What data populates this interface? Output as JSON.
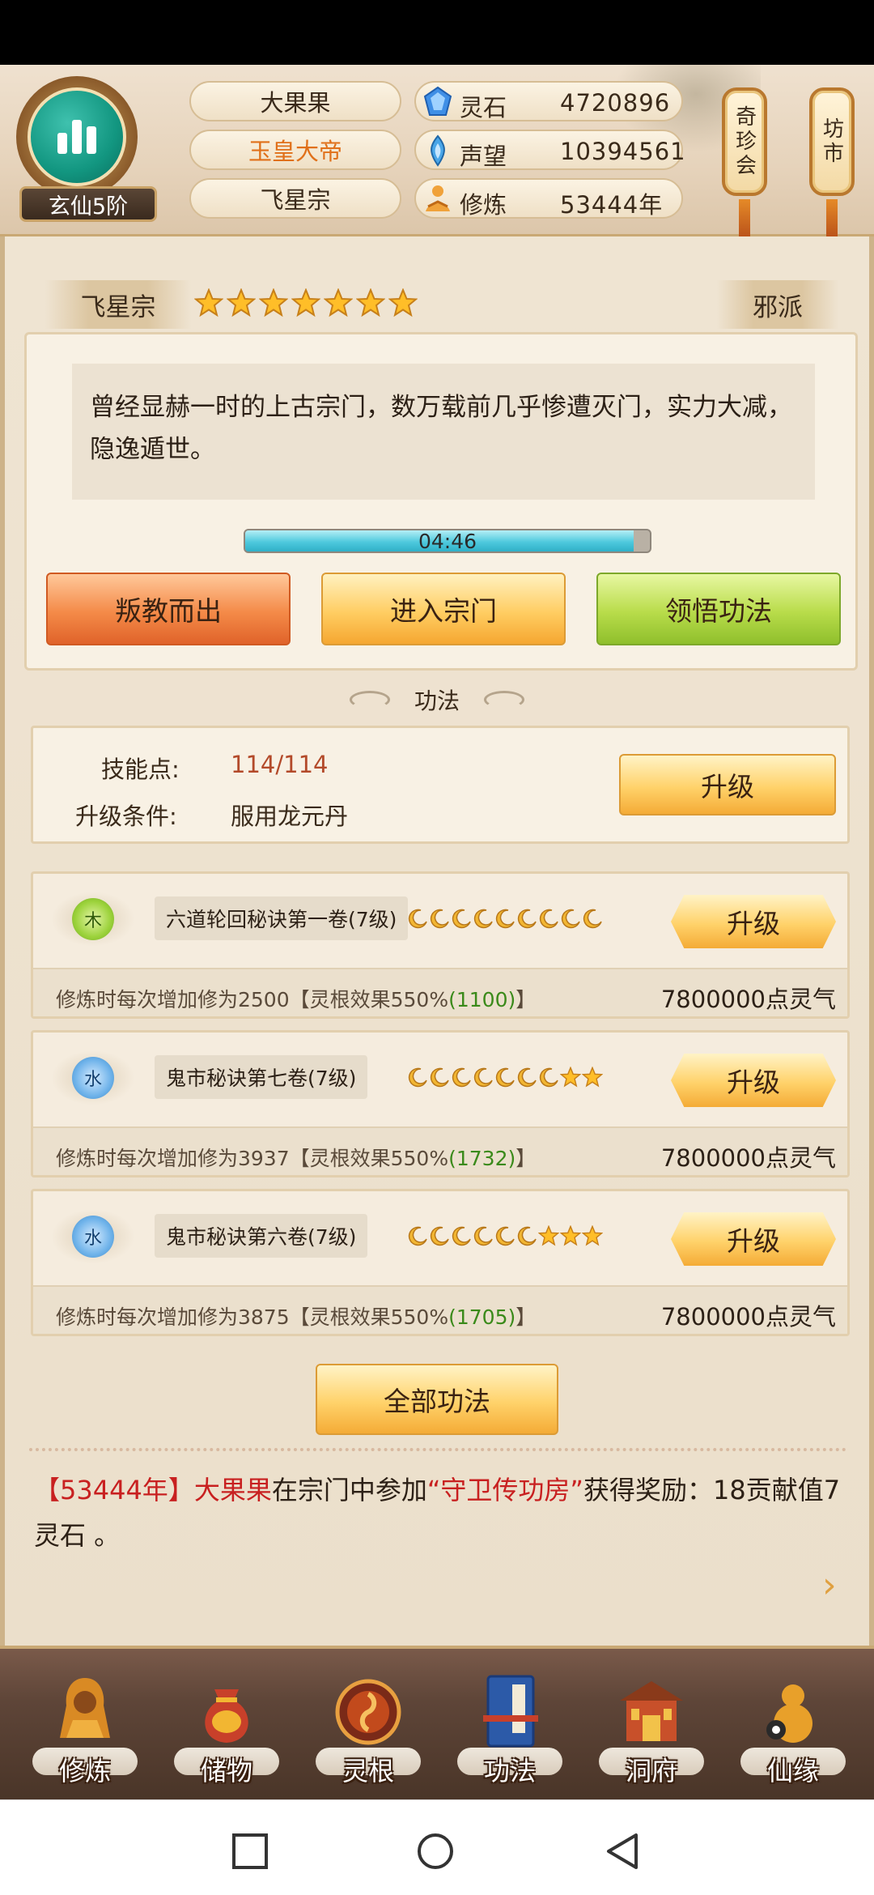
{
  "header": {
    "rank": "玄仙5阶",
    "player_name": "大果果",
    "title": "玉皇大帝",
    "sect": "飞星宗",
    "resources": [
      {
        "icon": "spirit-stone-icon",
        "label": "灵石",
        "value": "4720896"
      },
      {
        "icon": "prestige-icon",
        "label": "声望",
        "value": "10394561"
      },
      {
        "icon": "cultivation-icon",
        "label": "修炼",
        "value": "53444年"
      }
    ],
    "lanterns": [
      {
        "label": "奇珍会"
      },
      {
        "label": "坊市"
      }
    ]
  },
  "sect_info": {
    "name": "飞星宗",
    "stars": 7,
    "faction": "邪派",
    "description": "曾经显赫一时的上古宗门，数万载前几乎惨遭灭门，实力大减，隐逸遁世。",
    "timer": "04:46",
    "timer_progress": 0.96,
    "buttons": {
      "leave": "叛教而出",
      "enter": "进入宗门",
      "comprehend": "领悟功法"
    }
  },
  "skills_section": {
    "title": "功法",
    "points_label": "技能点:",
    "points_value": "114/114",
    "condition_label": "升级条件:",
    "condition_value": "服用龙元丹",
    "upgrade_label": "升级"
  },
  "techniques": [
    {
      "element": "木",
      "element_type": "wood",
      "name": "六道轮回秘诀第一卷(7级)",
      "moons": 9,
      "stars": 0,
      "desc_prefix": "修炼时每次增加修为2500【灵根效果550%",
      "desc_bonus": "(1100)",
      "desc_suffix": "】",
      "cost": "7800000点灵气",
      "upgrade_label": "升级"
    },
    {
      "element": "水",
      "element_type": "water",
      "name": "鬼市秘诀第七卷(7级)",
      "moons": 7,
      "stars": 2,
      "desc_prefix": "修炼时每次增加修为3937【灵根效果550%",
      "desc_bonus": "(1732)",
      "desc_suffix": "】",
      "cost": "7800000点灵气",
      "upgrade_label": "升级"
    },
    {
      "element": "水",
      "element_type": "water",
      "name": "鬼市秘诀第六卷(7级)",
      "moons": 6,
      "stars": 3,
      "desc_prefix": "修炼时每次增加修为3875【灵根效果550%",
      "desc_bonus": "(1705)",
      "desc_suffix": "】",
      "cost": "7800000点灵气",
      "upgrade_label": "升级"
    }
  ],
  "all_skills_button": "全部功法",
  "log": {
    "time": "【53444年】",
    "player": "大果果",
    "text1": "在宗门中参加",
    "event": "“守卫传功房”",
    "text2": "获得奖励：18贡献值7灵石 。"
  },
  "nav": [
    {
      "label": "修炼",
      "icon": "meditating-monk-icon"
    },
    {
      "label": "储物",
      "icon": "treasure-bag-icon"
    },
    {
      "label": "灵根",
      "icon": "spirit-root-icon"
    },
    {
      "label": "功法",
      "icon": "scroll-book-icon"
    },
    {
      "label": "洞府",
      "icon": "cave-palace-icon"
    },
    {
      "label": "仙缘",
      "icon": "gourd-icon"
    }
  ],
  "colors": {
    "accent_orange": "#e0701a",
    "highlight_red": "#c82020",
    "bonus_green": "#3a8a1a",
    "gold_button": "#ffd26a"
  }
}
